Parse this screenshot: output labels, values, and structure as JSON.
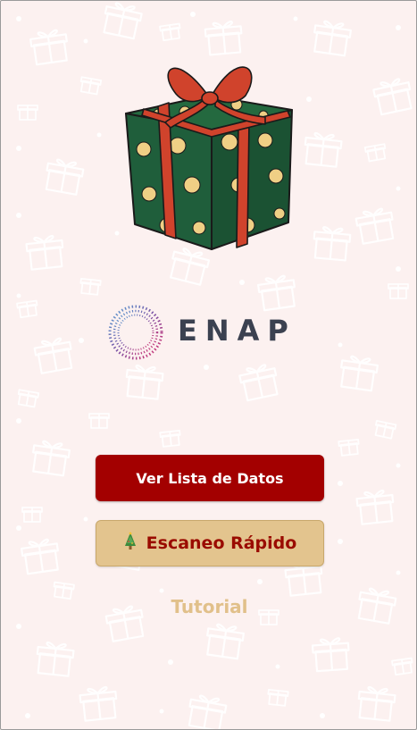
{
  "brand": {
    "name": "ENAP"
  },
  "actions": {
    "primary_label": "Ver Lista de Datos",
    "secondary_label": "Escaneo Rápido",
    "secondary_icon": "christmas-tree-icon",
    "tutorial_label": "Tutorial"
  },
  "colors": {
    "background": "#fcf1f0",
    "primary_button": "#a30000",
    "secondary_button": "#e3c48e",
    "secondary_text": "#9a0b00",
    "tutorial_text": "#e1c08a",
    "gift_box": "#1f5e3b",
    "gift_ribbon": "#d0432c",
    "gift_dots": "#efcf85"
  }
}
